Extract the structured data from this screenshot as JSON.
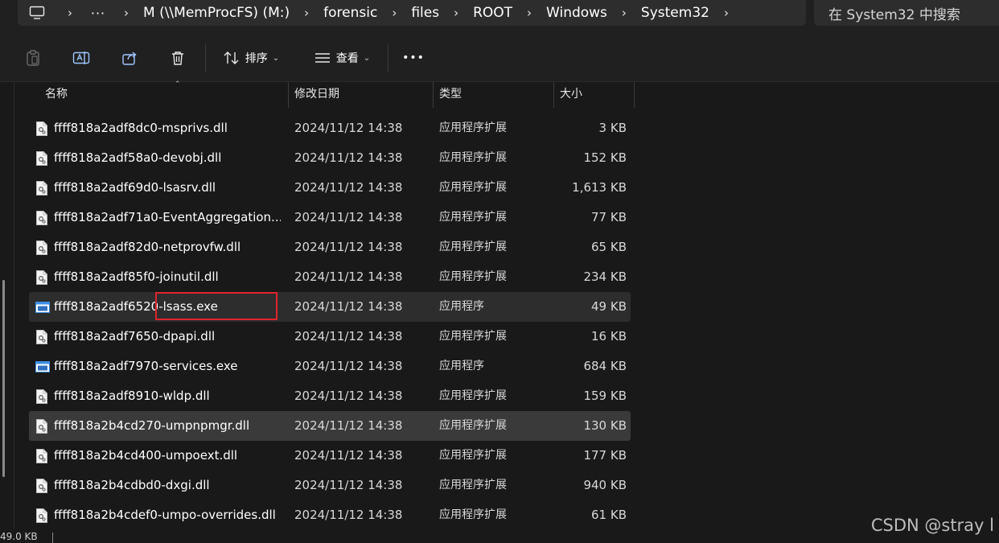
{
  "address_bar": {
    "more": "···",
    "separator": "›",
    "crumbs": [
      "M (\\\\MemProcFS) (M:)",
      "forensic",
      "files",
      "ROOT",
      "Windows",
      "System32"
    ],
    "search_placeholder": "在 System32 中搜索"
  },
  "toolbar": {
    "sort_label": "排序",
    "view_label": "查看",
    "more": "•••"
  },
  "columns": {
    "name": "名称",
    "date": "修改日期",
    "type": "类型",
    "size": "大小"
  },
  "files": [
    {
      "name": "ffff818a2adf8dc0-msprivs.dll",
      "date": "2024/11/12 14:38",
      "type": "应用程序扩展",
      "size": "3 KB",
      "kind": "dll"
    },
    {
      "name": "ffff818a2adf58a0-devobj.dll",
      "date": "2024/11/12 14:38",
      "type": "应用程序扩展",
      "size": "152 KB",
      "kind": "dll"
    },
    {
      "name": "ffff818a2adf69d0-lsasrv.dll",
      "date": "2024/11/12 14:38",
      "type": "应用程序扩展",
      "size": "1,613 KB",
      "kind": "dll"
    },
    {
      "name": "ffff818a2adf71a0-EventAggregation....",
      "date": "2024/11/12 14:38",
      "type": "应用程序扩展",
      "size": "77 KB",
      "kind": "dll"
    },
    {
      "name": "ffff818a2adf82d0-netprovfw.dll",
      "date": "2024/11/12 14:38",
      "type": "应用程序扩展",
      "size": "65 KB",
      "kind": "dll"
    },
    {
      "name": "ffff818a2adf85f0-joinutil.dll",
      "date": "2024/11/12 14:38",
      "type": "应用程序扩展",
      "size": "234 KB",
      "kind": "dll"
    },
    {
      "name": "ffff818a2adf6520-lsass.exe",
      "date": "2024/11/12 14:38",
      "type": "应用程序",
      "size": "49 KB",
      "kind": "exe",
      "state": "hover"
    },
    {
      "name": "ffff818a2adf7650-dpapi.dll",
      "date": "2024/11/12 14:38",
      "type": "应用程序扩展",
      "size": "16 KB",
      "kind": "dll"
    },
    {
      "name": "ffff818a2adf7970-services.exe",
      "date": "2024/11/12 14:38",
      "type": "应用程序",
      "size": "684 KB",
      "kind": "exe"
    },
    {
      "name": "ffff818a2adf8910-wldp.dll",
      "date": "2024/11/12 14:38",
      "type": "应用程序扩展",
      "size": "159 KB",
      "kind": "dll"
    },
    {
      "name": "ffff818a2b4cd270-umpnpmgr.dll",
      "date": "2024/11/12 14:38",
      "type": "应用程序扩展",
      "size": "130 KB",
      "kind": "dll",
      "state": "selected"
    },
    {
      "name": "ffff818a2b4cd400-umpoext.dll",
      "date": "2024/11/12 14:38",
      "type": "应用程序扩展",
      "size": "177 KB",
      "kind": "dll"
    },
    {
      "name": "ffff818a2b4cdbd0-dxgi.dll",
      "date": "2024/11/12 14:38",
      "type": "应用程序扩展",
      "size": "940 KB",
      "kind": "dll"
    },
    {
      "name": "ffff818a2b4cdef0-umpo-overrides.dll",
      "date": "2024/11/12 14:38",
      "type": "应用程序扩展",
      "size": "61 KB",
      "kind": "dll"
    }
  ],
  "status_bar": {
    "selection_size": "49.0 KB"
  },
  "watermark": "CSDN @stray l",
  "colors": {
    "background": "#191919",
    "selected_row": "#3a3a3a",
    "highlight_border": "#e0242a"
  }
}
